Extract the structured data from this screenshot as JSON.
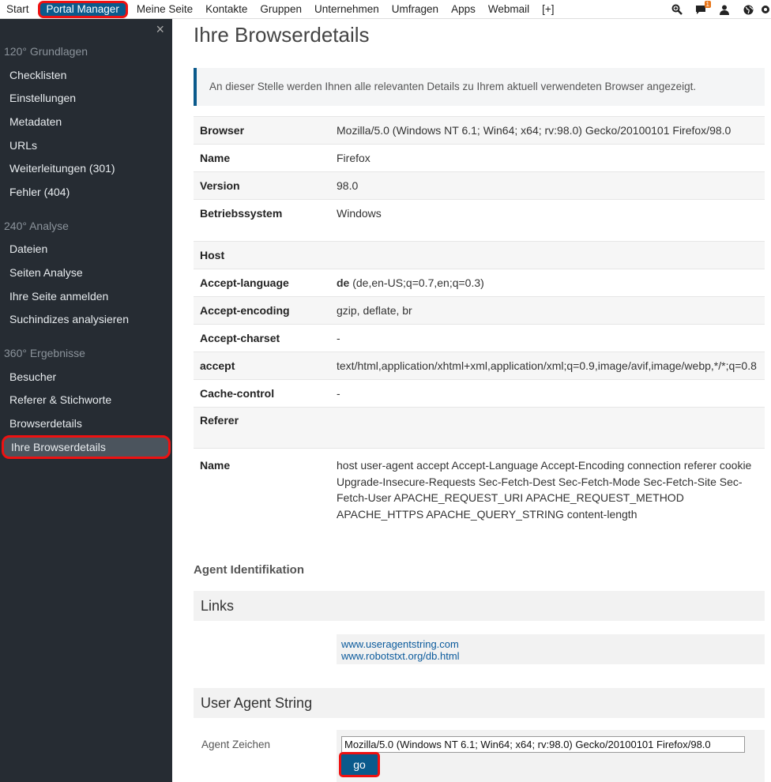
{
  "topnav": {
    "items": [
      "Start",
      "Portal Manager",
      "Meine Seite",
      "Kontakte",
      "Gruppen",
      "Unternehmen",
      "Umfragen",
      "Apps",
      "Webmail",
      "[+]"
    ],
    "badge_count": "1"
  },
  "sidebar": {
    "close": "×",
    "sections": [
      {
        "title": "120° Grundlagen",
        "items": [
          "Checklisten",
          "Einstellungen",
          "Metadaten",
          "URLs",
          "Weiterleitungen (301)",
          "Fehler (404)"
        ]
      },
      {
        "title": "240° Analyse",
        "items": [
          "Dateien",
          "Seiten Analyse",
          "Ihre Seite anmelden",
          "Suchindizes analysieren"
        ]
      },
      {
        "title": "360° Ergebnisse",
        "items": [
          "Besucher",
          "Referer & Stichworte",
          "Browserdetails",
          "Ihre Browserdetails"
        ]
      }
    ]
  },
  "main": {
    "title": "Ihre Browserdetails",
    "alert": "An dieser Stelle werden Ihnen alle relevanten Details zu Ihrem aktuell verwendeten Browser angezeigt.",
    "browser_table": [
      {
        "key": "Browser",
        "value": "Mozilla/5.0 (Windows NT 6.1; Win64; x64; rv:98.0) Gecko/20100101 Firefox/98.0"
      },
      {
        "key": "Name",
        "value": "Firefox"
      },
      {
        "key": "Version",
        "value": "98.0"
      },
      {
        "key": "Betriebssystem",
        "value": "Windows"
      }
    ],
    "header_table": [
      {
        "key": "Host",
        "value": ""
      },
      {
        "key": "Accept-language",
        "value_bold": "de",
        "value": " (de,en-US;q=0.7,en;q=0.3)"
      },
      {
        "key": "Accept-encoding",
        "value": "gzip, deflate, br"
      },
      {
        "key": "Accept-charset",
        "value": "-"
      },
      {
        "key": "accept",
        "value": "text/html,application/xhtml+xml,application/xml;q=0.9,image/avif,image/webp,*/*;q=0.8"
      },
      {
        "key": "Cache-control",
        "value": "-"
      },
      {
        "key": "Referer",
        "value": ""
      },
      {
        "key": "Name",
        "value": "host user-agent accept Accept-Language Accept-Encoding connection referer cookie Upgrade-Insecure-Requests Sec-Fetch-Dest Sec-Fetch-Mode Sec-Fetch-Site Sec-Fetch-User APACHE_REQUEST_URI APACHE_REQUEST_METHOD APACHE_HTTPS APACHE_QUERY_STRING content-length"
      }
    ],
    "agent_heading": "Agent Identifikation",
    "links_heading": "Links",
    "links": [
      "www.useragentstring.com",
      "www.robotstxt.org/db.html"
    ],
    "ua_heading": "User Agent String",
    "ua_label": "Agent Zeichen",
    "ua_value": "Mozilla/5.0 (Windows NT 6.1; Win64; x64; rv:98.0) Gecko/20100101 Firefox/98.0",
    "go_label": "go"
  }
}
